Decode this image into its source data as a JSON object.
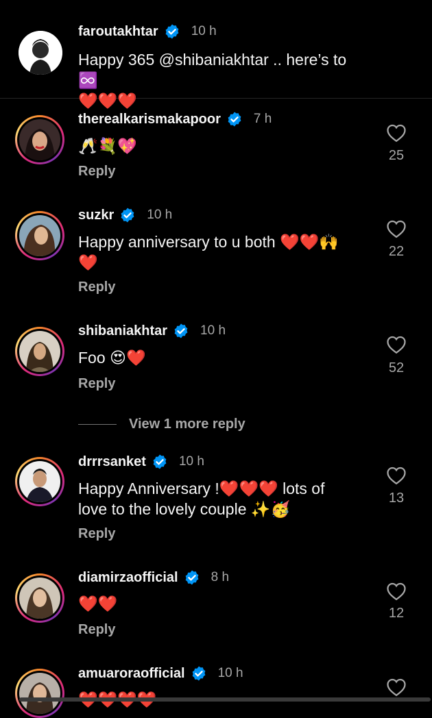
{
  "caption": {
    "username": "faroutakhtar",
    "time": "10 h",
    "text": "Happy 365 @shibaniakhtar .. here’s to ♾️\n❤️❤️❤️"
  },
  "comments": [
    {
      "username": "therealkarismakapoor",
      "time": "7 h",
      "text": "🥂💐💖",
      "reply": "Reply",
      "likes": "25"
    },
    {
      "username": "suzkr",
      "time": "10 h",
      "text": "Happy anniversary to u both ❤️❤️🙌\n❤️",
      "reply": "Reply",
      "likes": "22"
    },
    {
      "username": "shibaniakhtar",
      "time": "10 h",
      "text": "Foo 😍❤️",
      "reply": "Reply",
      "likes": "52"
    },
    {
      "username": "drrrsanket",
      "time": "10 h",
      "text": "Happy Anniversary !❤️❤️❤️ lots of\nlove to the lovely couple ✨🥳",
      "reply": "Reply",
      "likes": "13"
    },
    {
      "username": "diamirzaofficial",
      "time": "8 h",
      "text": "❤️❤️",
      "reply": "Reply",
      "likes": "12"
    },
    {
      "username": "amuaroraofficial",
      "time": "10 h",
      "text": "❤️❤️❤️❤️"
    }
  ],
  "view_more": "View 1 more reply",
  "colors": {
    "background": "#000000",
    "secondary_text": "#a8a8a8",
    "verified": "#0095f6"
  }
}
